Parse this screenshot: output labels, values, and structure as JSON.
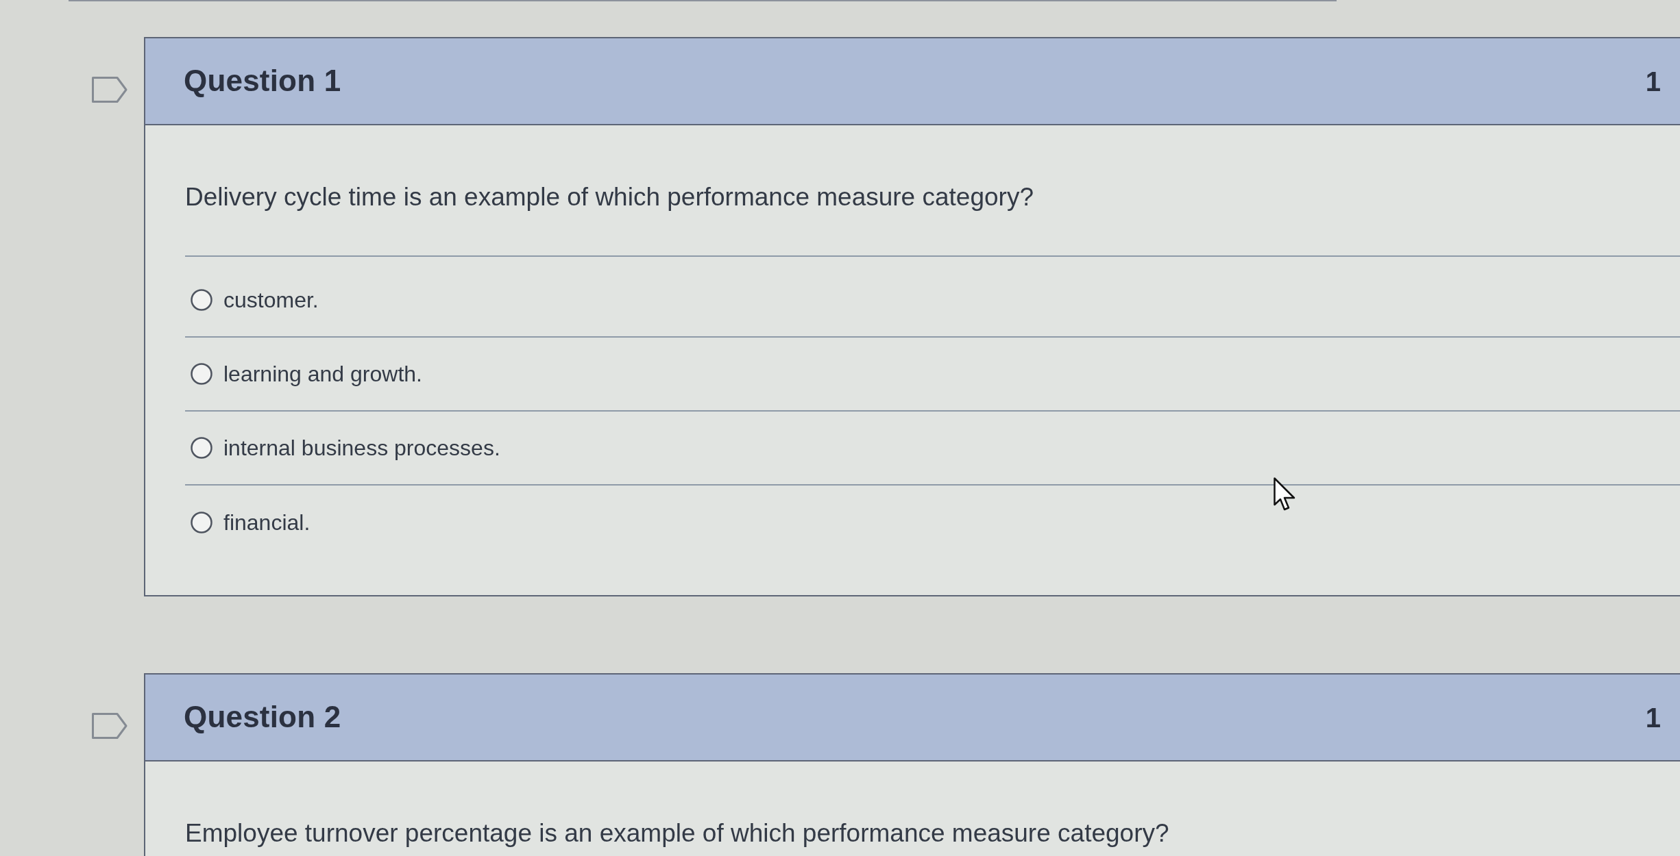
{
  "questions": [
    {
      "title": "Question 1",
      "points": "1",
      "flagged": false,
      "prompt": "Delivery cycle time is an example of which performance measure category?",
      "options": [
        {
          "label": "customer.",
          "selected": false
        },
        {
          "label": "learning and growth.",
          "selected": false
        },
        {
          "label": "internal business processes.",
          "selected": false
        },
        {
          "label": "financial.",
          "selected": false
        }
      ]
    },
    {
      "title": "Question 2",
      "points": "1",
      "flagged": false,
      "prompt": "Employee turnover percentage is an example of which performance measure category?"
    }
  ]
}
